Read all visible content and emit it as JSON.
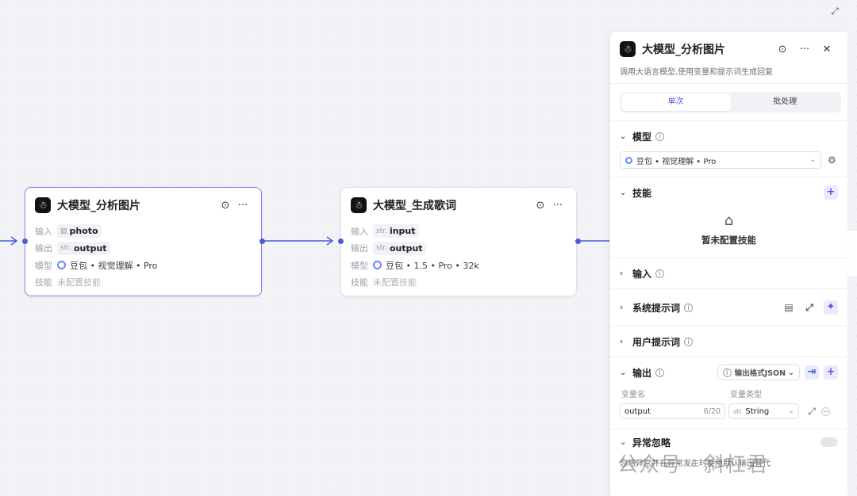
{
  "canvas": {
    "expand_icon": "expand-icon"
  },
  "node1": {
    "title": "大模型_分析图片",
    "input_label": "输入",
    "input_prefix": "▨",
    "input_value": "photo",
    "output_label": "输出",
    "output_prefix": "str.",
    "output_value": "output",
    "model_label": "模型",
    "model_value": "豆包 • 视觉理解 • Pro",
    "skill_label": "技能",
    "skill_value": "未配置技能"
  },
  "node2": {
    "title": "大模型_生成歌词",
    "input_label": "输入",
    "input_prefix": "str.",
    "input_value": "input",
    "output_label": "输出",
    "output_prefix": "str.",
    "output_value": "output",
    "model_label": "模型",
    "model_value": "豆包 • 1.5 • Pro • 32k",
    "skill_label": "技能",
    "skill_value": "未配置技能"
  },
  "panel": {
    "title": "大模型_分析图片",
    "description": "调用大语言模型,使用变量和提示词生成回复",
    "tabs": [
      "单次",
      "批处理"
    ],
    "active_tab": "单次",
    "model_section": "模型",
    "model_value": "豆包 • 视觉理解 • Pro",
    "skills_section": "技能",
    "skills_empty": "暂未配置技能",
    "input_section": "输入",
    "system_prompt_section": "系统提示词",
    "user_prompt_section": "用户提示词",
    "output_section": "输出",
    "output_format": "输出格式JSON",
    "col_var_name": "变量名",
    "col_var_type": "变量类型",
    "output_var_name": "output",
    "output_var_count": "6/20",
    "output_var_type_prefix": "str.",
    "output_var_type": "String",
    "error_section": "异常忽略",
    "error_desc": "忽略异常并在异常发生时使用默认输出替代"
  },
  "watermark": "公众号 · 斜杠君",
  "colors": {
    "accent": "#4d5bd8",
    "selected_border": "#8b7cf0",
    "edge": "#4d5bd8"
  }
}
